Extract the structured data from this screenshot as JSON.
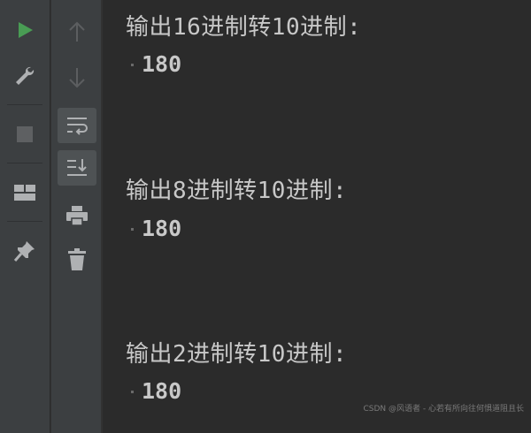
{
  "toolbar": {
    "primary": [
      {
        "name": "run-icon",
        "color": "#499c54"
      },
      {
        "name": "wrench-icon"
      },
      {
        "name": "stop-icon"
      },
      {
        "name": "layout-icon"
      },
      {
        "name": "pin-icon"
      }
    ],
    "secondary": [
      {
        "name": "arrow-up-icon"
      },
      {
        "name": "arrow-down-icon"
      },
      {
        "name": "soft-wrap-icon",
        "active": true
      },
      {
        "name": "scroll-to-end-icon",
        "active": true
      },
      {
        "name": "print-icon"
      },
      {
        "name": "trash-icon"
      }
    ]
  },
  "console": {
    "blocks": [
      {
        "heading": "输出16进制转10进制:",
        "value": "180"
      },
      {
        "heading": "输出8进制转10进制:",
        "value": "180"
      },
      {
        "heading": "输出2进制转10进制:",
        "value": "180"
      }
    ]
  },
  "watermark": "CSDN @风语者 - 心若有所向往何惧道阻且长"
}
